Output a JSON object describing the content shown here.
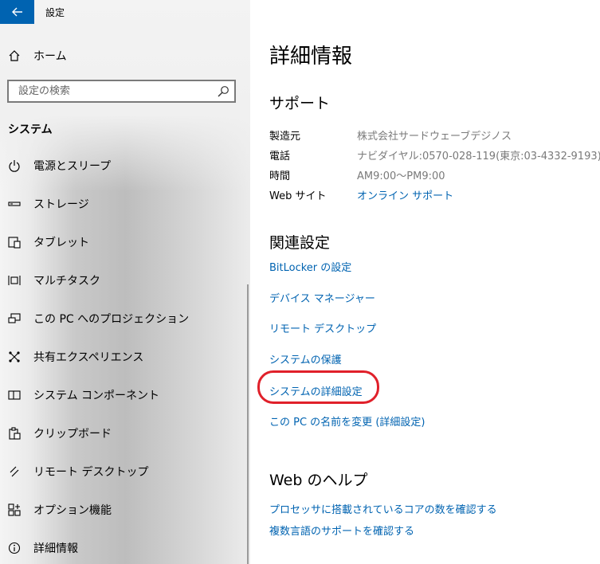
{
  "window": {
    "title": "設定",
    "back_icon": "back-arrow-icon"
  },
  "sidebar": {
    "home_label": "ホーム",
    "search": {
      "placeholder": "設定の検索"
    },
    "section_title": "システム",
    "items": [
      {
        "label": "電源とスリープ",
        "icon": "power-icon"
      },
      {
        "label": "ストレージ",
        "icon": "storage-icon"
      },
      {
        "label": "タブレット",
        "icon": "tablet-icon"
      },
      {
        "label": "マルチタスク",
        "icon": "multitask-icon"
      },
      {
        "label": "この PC へのプロジェクション",
        "icon": "projection-icon"
      },
      {
        "label": "共有エクスペリエンス",
        "icon": "shared-experience-icon"
      },
      {
        "label": "システム コンポーネント",
        "icon": "system-components-icon"
      },
      {
        "label": "クリップボード",
        "icon": "clipboard-icon"
      },
      {
        "label": "リモート デスクトップ",
        "icon": "remote-desktop-icon"
      },
      {
        "label": "オプション機能",
        "icon": "optional-features-icon"
      },
      {
        "label": "詳細情報",
        "icon": "info-icon"
      }
    ]
  },
  "main": {
    "title": "詳細情報",
    "support": {
      "heading": "サポート",
      "rows": [
        {
          "key": "製造元",
          "value": "株式会社サードウェーブデジノス"
        },
        {
          "key": "電話",
          "value": "ナビダイヤル:0570-028-119(東京:03-4332-9193)"
        },
        {
          "key": "時間",
          "value": "AM9:00～PM9:00"
        },
        {
          "key": "Web サイト",
          "value": "オンライン サポート"
        }
      ]
    },
    "related": {
      "heading": "関連設定",
      "links": [
        "BitLocker の設定",
        "デバイス マネージャー",
        "リモート デスクトップ",
        "システムの保護",
        "システムの詳細設定",
        "この PC の名前を変更 (詳細設定)"
      ]
    },
    "web_help": {
      "heading": "Web のヘルプ",
      "links": [
        "プロセッサに搭載されているコアの数を確認する",
        "複数言語のサポートを確認する"
      ]
    }
  },
  "colors": {
    "accent": "#0063b1",
    "highlight": "#e0202a",
    "muted_text": "#7a7a7a"
  }
}
